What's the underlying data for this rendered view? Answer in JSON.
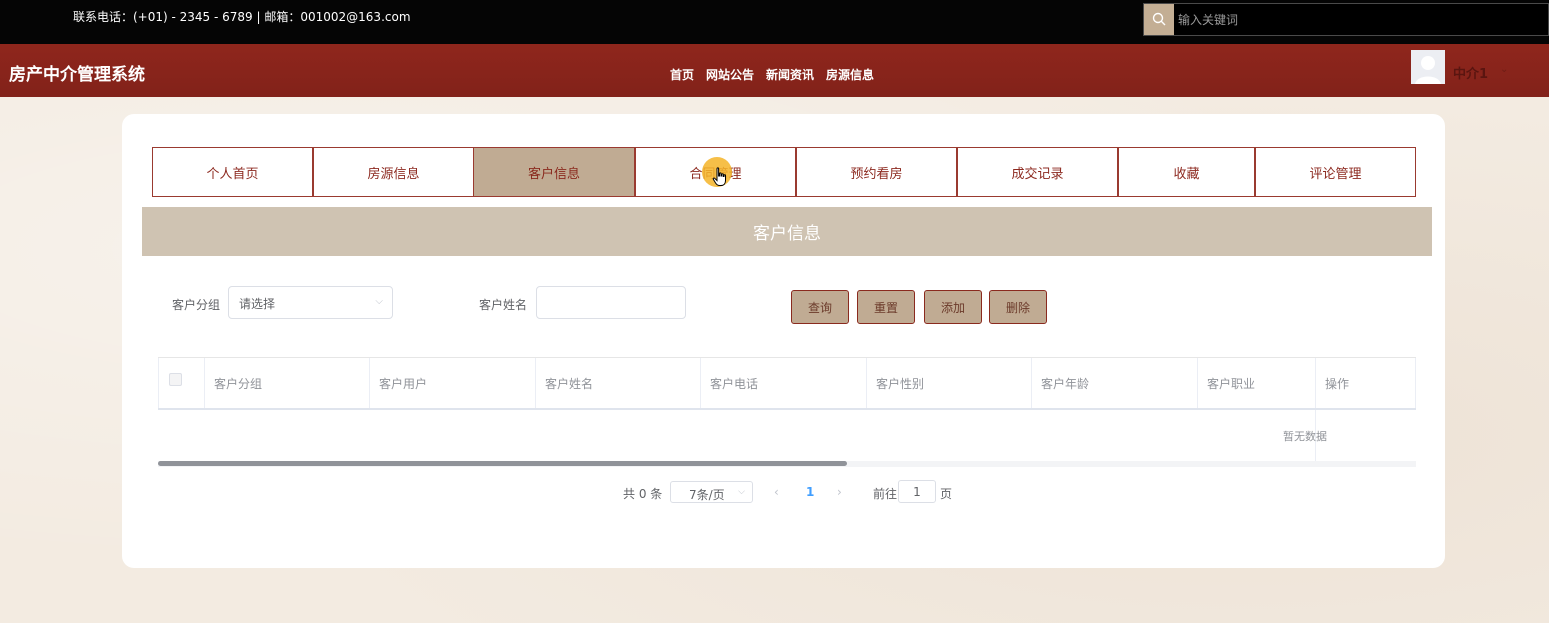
{
  "topbar": {
    "contact": "联系电话：(+01) - 2345 - 6789 | 邮箱：001002@163.com",
    "search_placeholder": "输入关键词",
    "search_icon": "search-icon"
  },
  "header": {
    "title": "房产中介管理系统",
    "nav": [
      "首页",
      "网站公告",
      "新闻资讯",
      "房源信息"
    ],
    "user_name": "中介1",
    "user_caret": "⌄"
  },
  "tabs": [
    "个人首页",
    "房源信息",
    "客户信息",
    "合同管理",
    "预约看房",
    "成交记录",
    "收藏",
    "评论管理"
  ],
  "active_tab": "客户信息",
  "section_title": "客户信息",
  "filters": {
    "group_label": "客户分组",
    "group_placeholder": "请选择",
    "name_label": "客户姓名",
    "name_value": ""
  },
  "buttons": {
    "query": "查询",
    "reset": "重置",
    "add": "添加",
    "delete": "删除"
  },
  "table": {
    "columns": [
      "客户分组",
      "客户用户",
      "客户姓名",
      "客户电话",
      "客户性别",
      "客户年龄",
      "客户职业",
      "操作"
    ],
    "empty_text": "暂无数据"
  },
  "pagination": {
    "total": "共 0 条",
    "page_size": "7条/页",
    "prev": "‹",
    "current_page": "1",
    "next": "›",
    "goto_label": "前往",
    "goto_value": "1",
    "goto_unit": "页"
  },
  "colors": {
    "header_bg": "#8f261c",
    "accent_tan": "#c0ab93",
    "banner": "#cfc3b2"
  }
}
